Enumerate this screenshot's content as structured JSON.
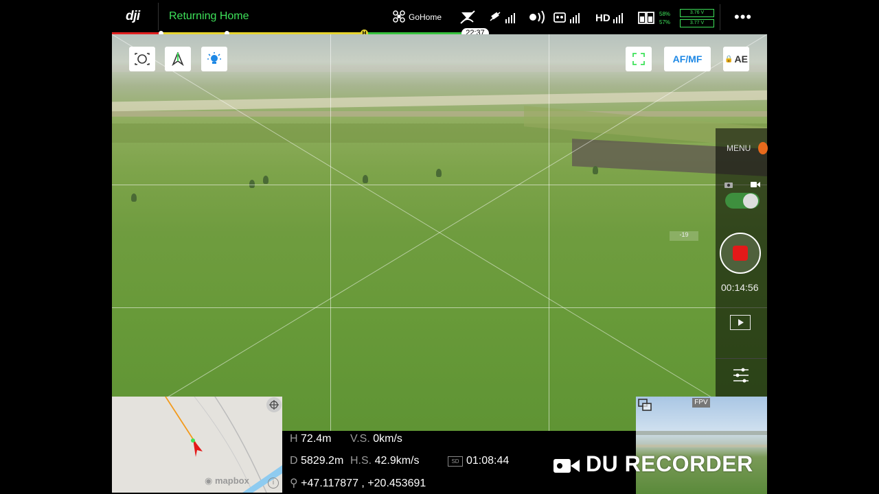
{
  "header": {
    "logo": "dji",
    "status": "Returning Home",
    "gohome_label": "GoHome",
    "hd_label": "HD",
    "battery_remote_pct": "58%",
    "battery_aircraft_pct": "57%",
    "cell_voltage_1": "3.76 V",
    "cell_voltage_2": "3.77 V",
    "flight_time_remaining": "22:37",
    "progress_marker": "H",
    "more_icon": "more-dots-icon"
  },
  "camera_controls": {
    "af_mf_label": "AF/MF",
    "ae_label": "AE"
  },
  "right_panel": {
    "menu_label": "MENU",
    "recording_time": "00:14:56",
    "ev_value": "-19"
  },
  "telemetry": {
    "height_label": "H",
    "height_value": "72.4m",
    "vs_label": "V.S.",
    "vs_value": "0km/s",
    "distance_label": "D",
    "distance_value": "5829.2m",
    "hs_label": "H.S.",
    "hs_value": "42.9km/s",
    "sd_label": "SD",
    "remaining_time": "01:08:44",
    "coordinates": "+47.117877 , +20.453691"
  },
  "map": {
    "attribution": "mapbox"
  },
  "fpv": {
    "label": "FPV"
  },
  "watermark": {
    "text": "DU RECORDER"
  },
  "colors": {
    "status_green": "#3ee25a",
    "record_red": "#e31919",
    "accent_blue": "#1e88e5"
  }
}
